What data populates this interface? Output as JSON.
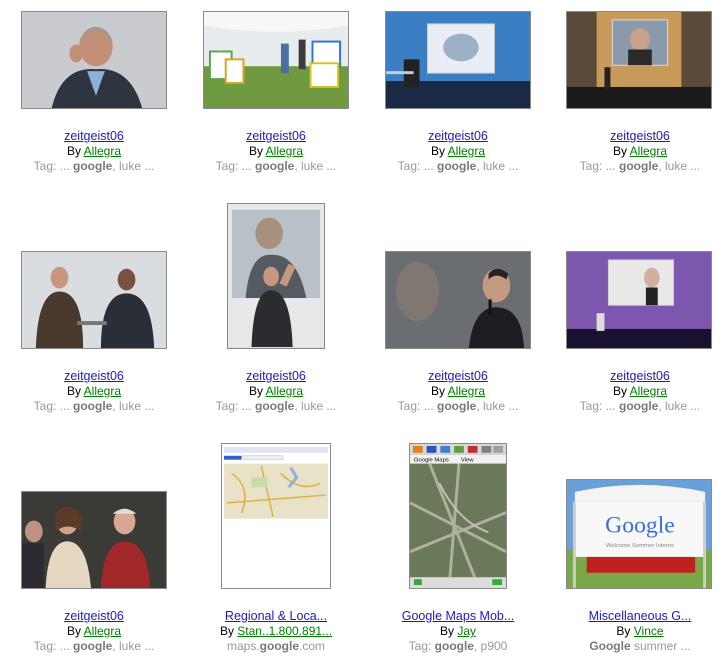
{
  "results": [
    {
      "title": "zeitgeist06",
      "by_prefix": "By",
      "author": "Allegra",
      "tag_prefix": "Tag: ... ",
      "tag_bold": "google",
      "tag_suffix": ", luke ...",
      "image": "man-speaking-portrait"
    },
    {
      "title": "zeitgeist06",
      "by_prefix": "By",
      "author": "Allegra",
      "tag_prefix": "Tag: ... ",
      "tag_bold": "google",
      "tag_suffix": ", luke ...",
      "image": "outdoor-tent-event"
    },
    {
      "title": "zeitgeist06",
      "by_prefix": "By",
      "author": "Allegra",
      "tag_prefix": "Tag: ... ",
      "tag_bold": "google",
      "tag_suffix": ", luke ...",
      "image": "stage-presentation-blue"
    },
    {
      "title": "zeitgeist06",
      "by_prefix": "By",
      "author": "Allegra",
      "tag_prefix": "Tag: ... ",
      "tag_bold": "google",
      "tag_suffix": ", luke ...",
      "image": "stage-presentation-orange"
    },
    {
      "title": "zeitgeist06",
      "by_prefix": "By",
      "author": "Allegra",
      "tag_prefix": "Tag: ... ",
      "tag_bold": "google",
      "tag_suffix": ", luke ...",
      "image": "two-men-seated"
    },
    {
      "title": "zeitgeist06",
      "by_prefix": "By",
      "author": "Allegra",
      "tag_prefix": "Tag: ... ",
      "tag_bold": "google",
      "tag_suffix": ", luke ...",
      "image": "speaker-big-screen"
    },
    {
      "title": "zeitgeist06",
      "by_prefix": "By",
      "author": "Allegra",
      "tag_prefix": "Tag: ... ",
      "tag_bold": "google",
      "tag_suffix": ", luke ...",
      "image": "man-with-microphone"
    },
    {
      "title": "zeitgeist06",
      "by_prefix": "By",
      "author": "Allegra",
      "tag_prefix": "Tag: ... ",
      "tag_bold": "google",
      "tag_suffix": ", luke ...",
      "image": "stage-purple"
    },
    {
      "title": "zeitgeist06",
      "by_prefix": "By",
      "author": "Allegra",
      "tag_prefix": "Tag: ... ",
      "tag_bold": "google",
      "tag_suffix": ", luke ...",
      "image": "audience-group"
    },
    {
      "title": "Regional & Loca...",
      "by_prefix": "By",
      "author": "Stan..1.800.891...",
      "tag_prefix": "maps.",
      "tag_bold": "google",
      "tag_suffix": ".com",
      "image": "maps-screenshot"
    },
    {
      "title": "Google Maps Mob...",
      "by_prefix": "By",
      "author": "Jay",
      "tag_prefix": "Tag: ",
      "tag_bold": "google",
      "tag_suffix": ", p900",
      "image": "mobile-maps-satellite"
    },
    {
      "title": "Miscellaneous G...",
      "by_prefix": "By",
      "author": "Vince",
      "tag_prefix": "",
      "tag_bold": "Google",
      "tag_suffix": " summer ...",
      "image": "google-tent-banner"
    }
  ],
  "banner": {
    "logo_text": "Google",
    "welcome_text": "Welcome Summer Interns"
  },
  "phone": {
    "menu_left": "Google Maps",
    "menu_right": "View"
  }
}
